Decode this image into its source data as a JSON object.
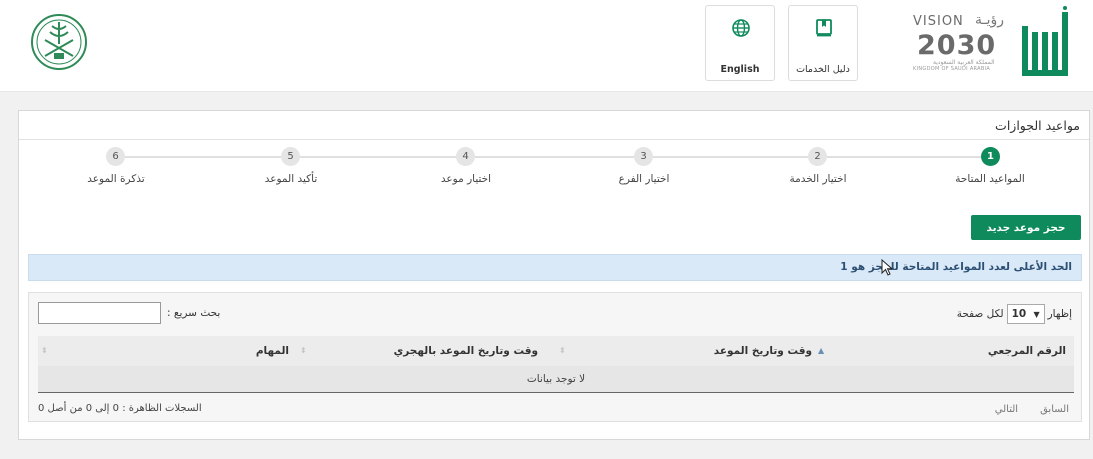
{
  "header": {
    "english_label": "English",
    "services_guide_label": "دليل الخدمات",
    "vision": {
      "word": "VISION",
      "arabic": "رؤيـة",
      "year": "2030",
      "sub_ar": "المملكة العربية السعودية",
      "sub_en": "KINGDOM OF SAUDI ARABIA"
    }
  },
  "page": {
    "title": "مواعيد الجوازات"
  },
  "steps": [
    {
      "number": "1",
      "label": "المواعيد المتاحة",
      "active": true
    },
    {
      "number": "2",
      "label": "اختيار الخدمة",
      "active": false
    },
    {
      "number": "3",
      "label": "اختيار الفرع",
      "active": false
    },
    {
      "number": "4",
      "label": "اختيار موعد",
      "active": false
    },
    {
      "number": "5",
      "label": "تأكيد الموعد",
      "active": false
    },
    {
      "number": "6",
      "label": "تذكرة الموعد",
      "active": false
    }
  ],
  "actions": {
    "new_appointment": "حجز موعد جديد"
  },
  "info": {
    "max_appointments": "الحد الأعلى لعدد المواعيد المتاحة للحجز هو 1"
  },
  "table": {
    "show_label": "إظهار",
    "page_size": "10",
    "per_page_label": "لكل صفحة",
    "search_label": "بحث سريع :",
    "columns": [
      "الرقم المرجعي",
      "وقت وتاريخ الموعد",
      "وقت وتاريخ الموعد بالهجري",
      "المهام"
    ],
    "empty_text": "لا توجد بيانات",
    "records_info": "السجلات الظاهرة : 0 إلى 0 من أصل 0",
    "previous": "السابق",
    "next": "التالي"
  },
  "colors": {
    "primary_green": "#0f8a5c",
    "info_bg": "#d9e9f7",
    "info_text": "#2c4f74"
  },
  "icons": [
    "globe-icon",
    "book-icon",
    "saudi-emblem-icon",
    "vision-2030-logo",
    "absher-logo",
    "cursor-icon",
    "sort-icon",
    "chevron-down-icon"
  ]
}
